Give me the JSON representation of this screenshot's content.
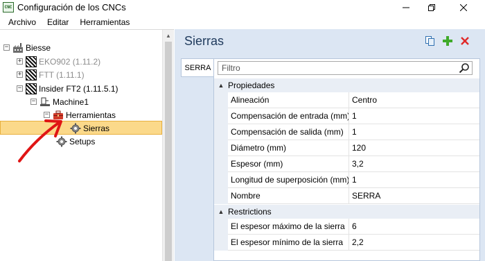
{
  "window": {
    "title": "Configuración de los CNCs",
    "app_icon_text": "CNC",
    "controls": [
      "minimize-icon",
      "restore-icon",
      "close-icon"
    ]
  },
  "menu": {
    "items": [
      {
        "label": "Archivo"
      },
      {
        "label": "Editar"
      },
      {
        "label": "Herramientas"
      }
    ]
  },
  "tree": {
    "root": {
      "label": "Biesse",
      "expander": "−"
    },
    "machines": [
      {
        "label": "EKO902 (1.11.2)",
        "expander": "+",
        "disabled": true
      },
      {
        "label": "FTT (1.11.1)",
        "expander": "+",
        "disabled": true
      },
      {
        "label": "Insider FT2 (1.11.5.1)",
        "expander": "−",
        "disabled": false
      }
    ],
    "machine1": {
      "label": "Machine1",
      "expander": "−"
    },
    "herramientas": {
      "label": "Herramientas",
      "expander": "−"
    },
    "sierras": {
      "label": "Sierras",
      "selected": true
    },
    "setups": {
      "label": "Setups"
    }
  },
  "panel": {
    "title": "Sierras",
    "header_icons": [
      "copy-icon",
      "add-icon",
      "delete-icon"
    ],
    "tab": "SERRA",
    "filter_placeholder": "Filtro",
    "categories": [
      {
        "name": "Propiedades",
        "properties": [
          {
            "name": "Alineación",
            "value": "Centro"
          },
          {
            "name": "Compensación de entrada (mm)",
            "value": "1"
          },
          {
            "name": "Compensación de salida (mm)",
            "value": "1"
          },
          {
            "name": "Diámetro (mm)",
            "value": "120"
          },
          {
            "name": "Espesor (mm)",
            "value": "3,2"
          },
          {
            "name": "Longitud de superposición (mm)",
            "value": "1"
          },
          {
            "name": "Nombre",
            "value": "SERRA"
          }
        ]
      },
      {
        "name": "Restrictions",
        "properties": [
          {
            "name": "El espesor máximo de la sierra",
            "value": "6"
          },
          {
            "name": "El espesor mínimo de la sierra",
            "value": "2,2"
          }
        ]
      }
    ]
  },
  "colors": {
    "selection": "#fbd98a",
    "panel_bg": "#dce6f3",
    "title_color": "#1f3a5c",
    "annotation_arrow": "#e01515"
  }
}
